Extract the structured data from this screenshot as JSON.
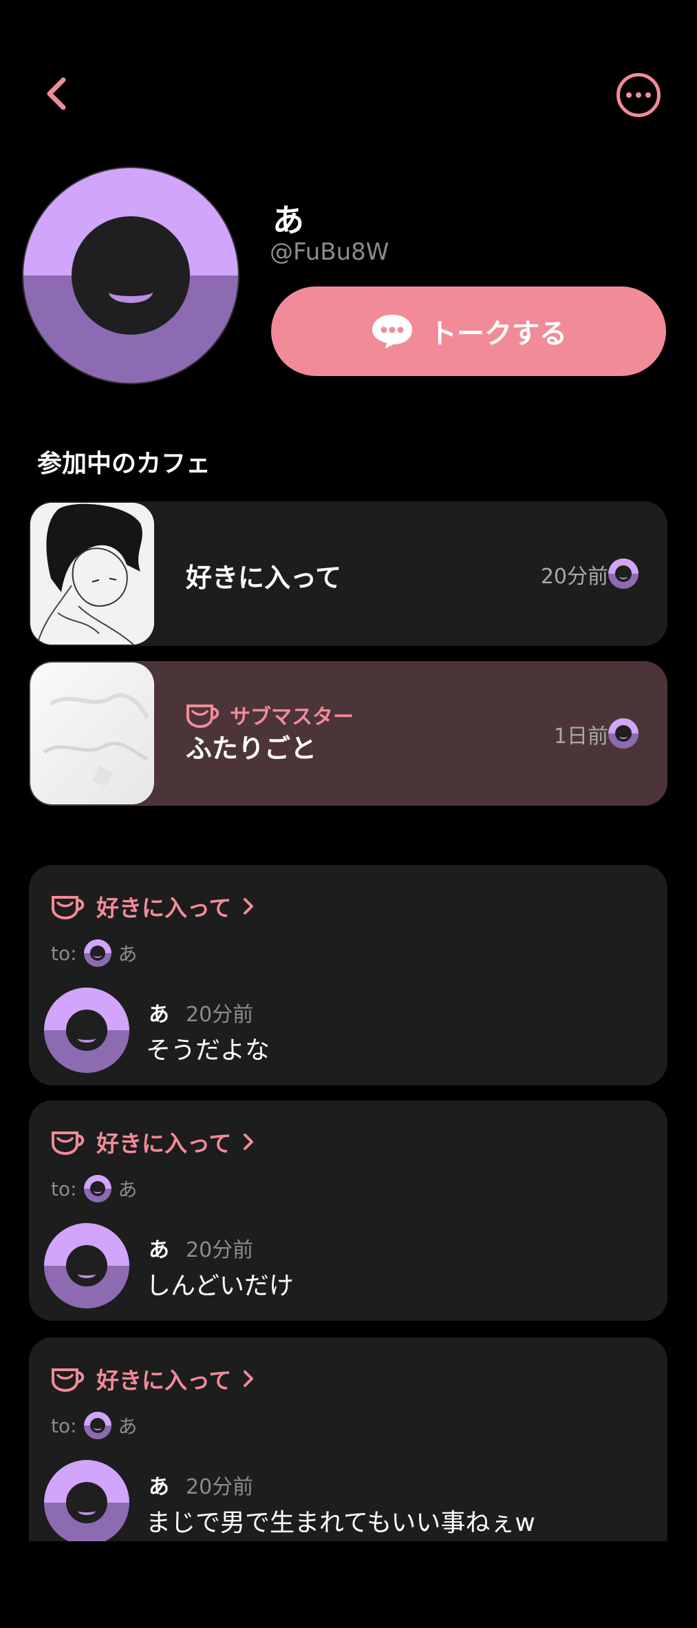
{
  "header": {
    "back_icon": "chevron-left-icon",
    "more_icon": "ellipsis-circle-icon"
  },
  "profile": {
    "name": "あ",
    "handle": "@FuBu8W",
    "talk_button": "トークする"
  },
  "cafes_section": {
    "title": "参加中のカフェ",
    "items": [
      {
        "name": "好きに入って",
        "time": "20分前",
        "role": ""
      },
      {
        "name": "ふたりごと",
        "time": "1日前",
        "role": "サブマスター"
      }
    ]
  },
  "posts": [
    {
      "cafe": "好きに入って",
      "to_label": "to:",
      "to_name": "あ",
      "author": "あ",
      "time": "20分前",
      "body": "そうだよな"
    },
    {
      "cafe": "好きに入って",
      "to_label": "to:",
      "to_name": "あ",
      "author": "あ",
      "time": "20分前",
      "body": "しんどいだけ"
    },
    {
      "cafe": "好きに入って",
      "to_label": "to:",
      "to_name": "あ",
      "author": "あ",
      "time": "20分前",
      "body": "まじで男で生まれてもいい事ねぇw"
    }
  ],
  "colors": {
    "accent": "#f28b98",
    "avatar_top": "#d1a5fb",
    "avatar_bottom": "#8d6bb2",
    "card": "#1d1d1d",
    "card_highlight": "#4b3538"
  }
}
